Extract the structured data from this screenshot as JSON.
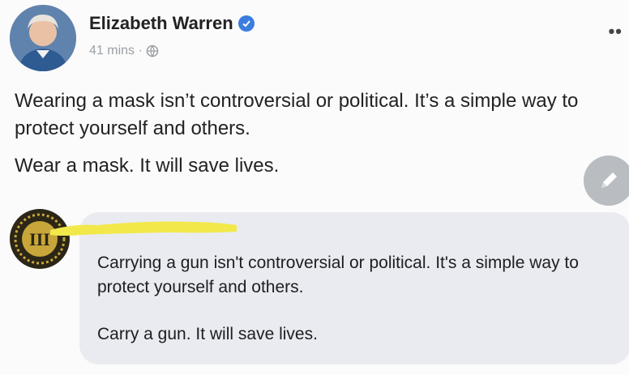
{
  "post": {
    "author": "Elizabeth Warren",
    "time": "41 mins ·",
    "privacy_icon": "globe-icon",
    "more_label": "••",
    "paragraphs": [
      "Wearing a mask isn’t controversial or political. It’s a simple way to protect yourself and others.",
      "Wear a mask. It will save lives."
    ]
  },
  "comment": {
    "emblem_text": "III",
    "paragraphs": [
      "Carrying a gun isn't controversial or political. It's a simple way to protect yourself and others.",
      "Carry a gun. It will save lives."
    ]
  },
  "colors": {
    "verified": "#3b7de0",
    "bubble": "#e9ebf0",
    "redaction": "#f2e84a",
    "fab": "#b9bcc0"
  }
}
